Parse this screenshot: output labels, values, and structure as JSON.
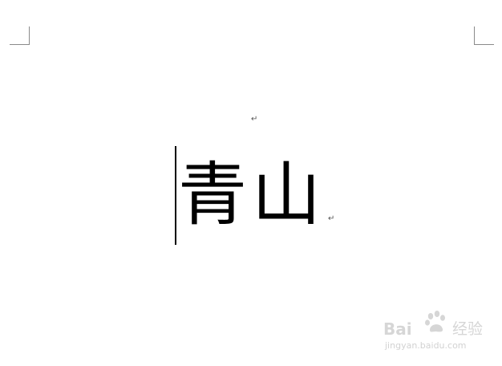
{
  "document": {
    "text": "青山",
    "paragraph_mark": "↵"
  },
  "watermark": {
    "brand_latin_1": "Bai",
    "brand_latin_2": "",
    "brand_cn": "经验",
    "site": "jingyan.baidu.com",
    "icon": "baidu-paw-icon"
  }
}
